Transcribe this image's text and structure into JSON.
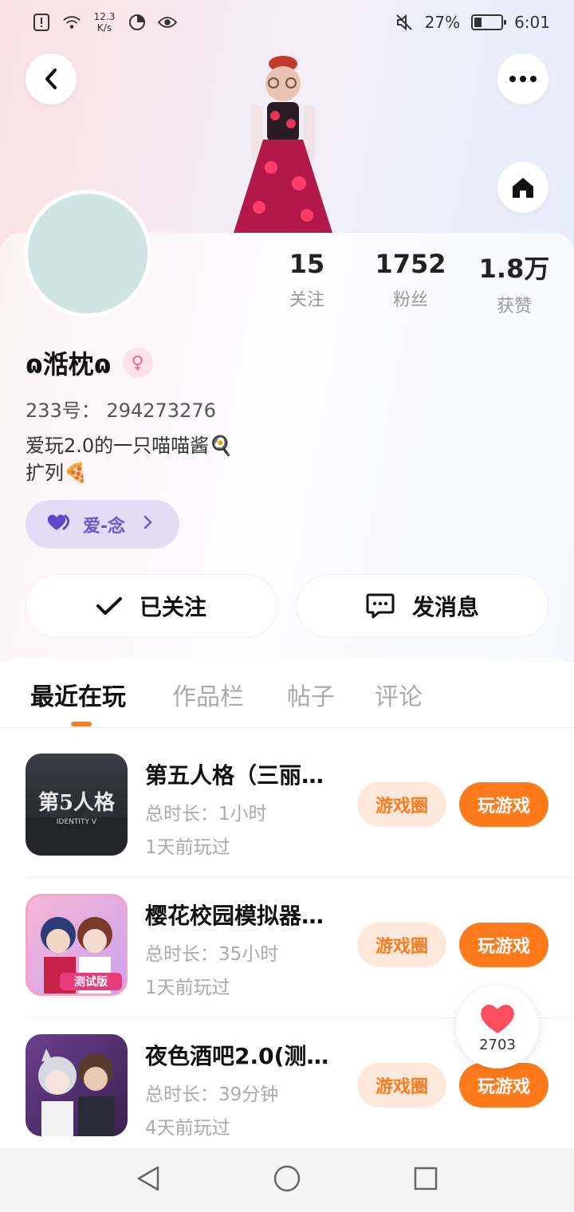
{
  "status_bar": {
    "net_speed_value": "12.3",
    "net_speed_unit": "K/s",
    "battery_percent": "27%",
    "battery_level": 0.27,
    "time": "6:01",
    "icons": [
      "alert-icon",
      "wifi-icon",
      "data-saver-icon",
      "eye-icon",
      "mute-icon",
      "battery-icon"
    ]
  },
  "header": {
    "back_icon": "chevron-left-icon",
    "more_icon": "more-horizontal-icon",
    "home_icon": "home-icon"
  },
  "profile": {
    "avatar_color": "#cfe3e0",
    "nickname": "ɷ湉枕ɷ",
    "gender_symbol": "♀",
    "uid": "233号： 294273276",
    "bio_line1": "爱玩2.0的一只喵喵酱🍳",
    "bio_line2": "扩列🍕",
    "tag_label": "爱-念",
    "stats": [
      {
        "value": "15",
        "label": "关注"
      },
      {
        "value": "1752",
        "label": "粉丝"
      },
      {
        "value": "1.8万",
        "label": "获赞"
      }
    ]
  },
  "actions": {
    "follow_label": "已关注",
    "message_label": "发消息"
  },
  "tabs": [
    "最近在玩",
    "作品栏",
    "帖子",
    "评论"
  ],
  "games": [
    {
      "title": "第五人格（三丽…",
      "duration": "总时长：1小时",
      "last_played": "1天前玩过",
      "circle_label": "游戏圈",
      "play_label": "玩游戏",
      "icon_text": "第5人格",
      "icon_sub": "IDENTITY V"
    },
    {
      "title": "樱花校园模拟器…",
      "duration": "总时长：35小时",
      "last_played": "1天前玩过",
      "circle_label": "游戏圈",
      "play_label": "玩游戏",
      "icon_text": "测试版"
    },
    {
      "title": "夜色酒吧2.0(测…",
      "duration": "总时长：39分钟",
      "last_played": "4天前玩过",
      "circle_label": "游戏圈",
      "play_label": "玩游戏"
    }
  ],
  "like_float": {
    "count": "2703",
    "heart_color": "#ff4d5e"
  },
  "colors": {
    "accent": "#ff7a1a",
    "tag_purple": "#6e58c9"
  }
}
